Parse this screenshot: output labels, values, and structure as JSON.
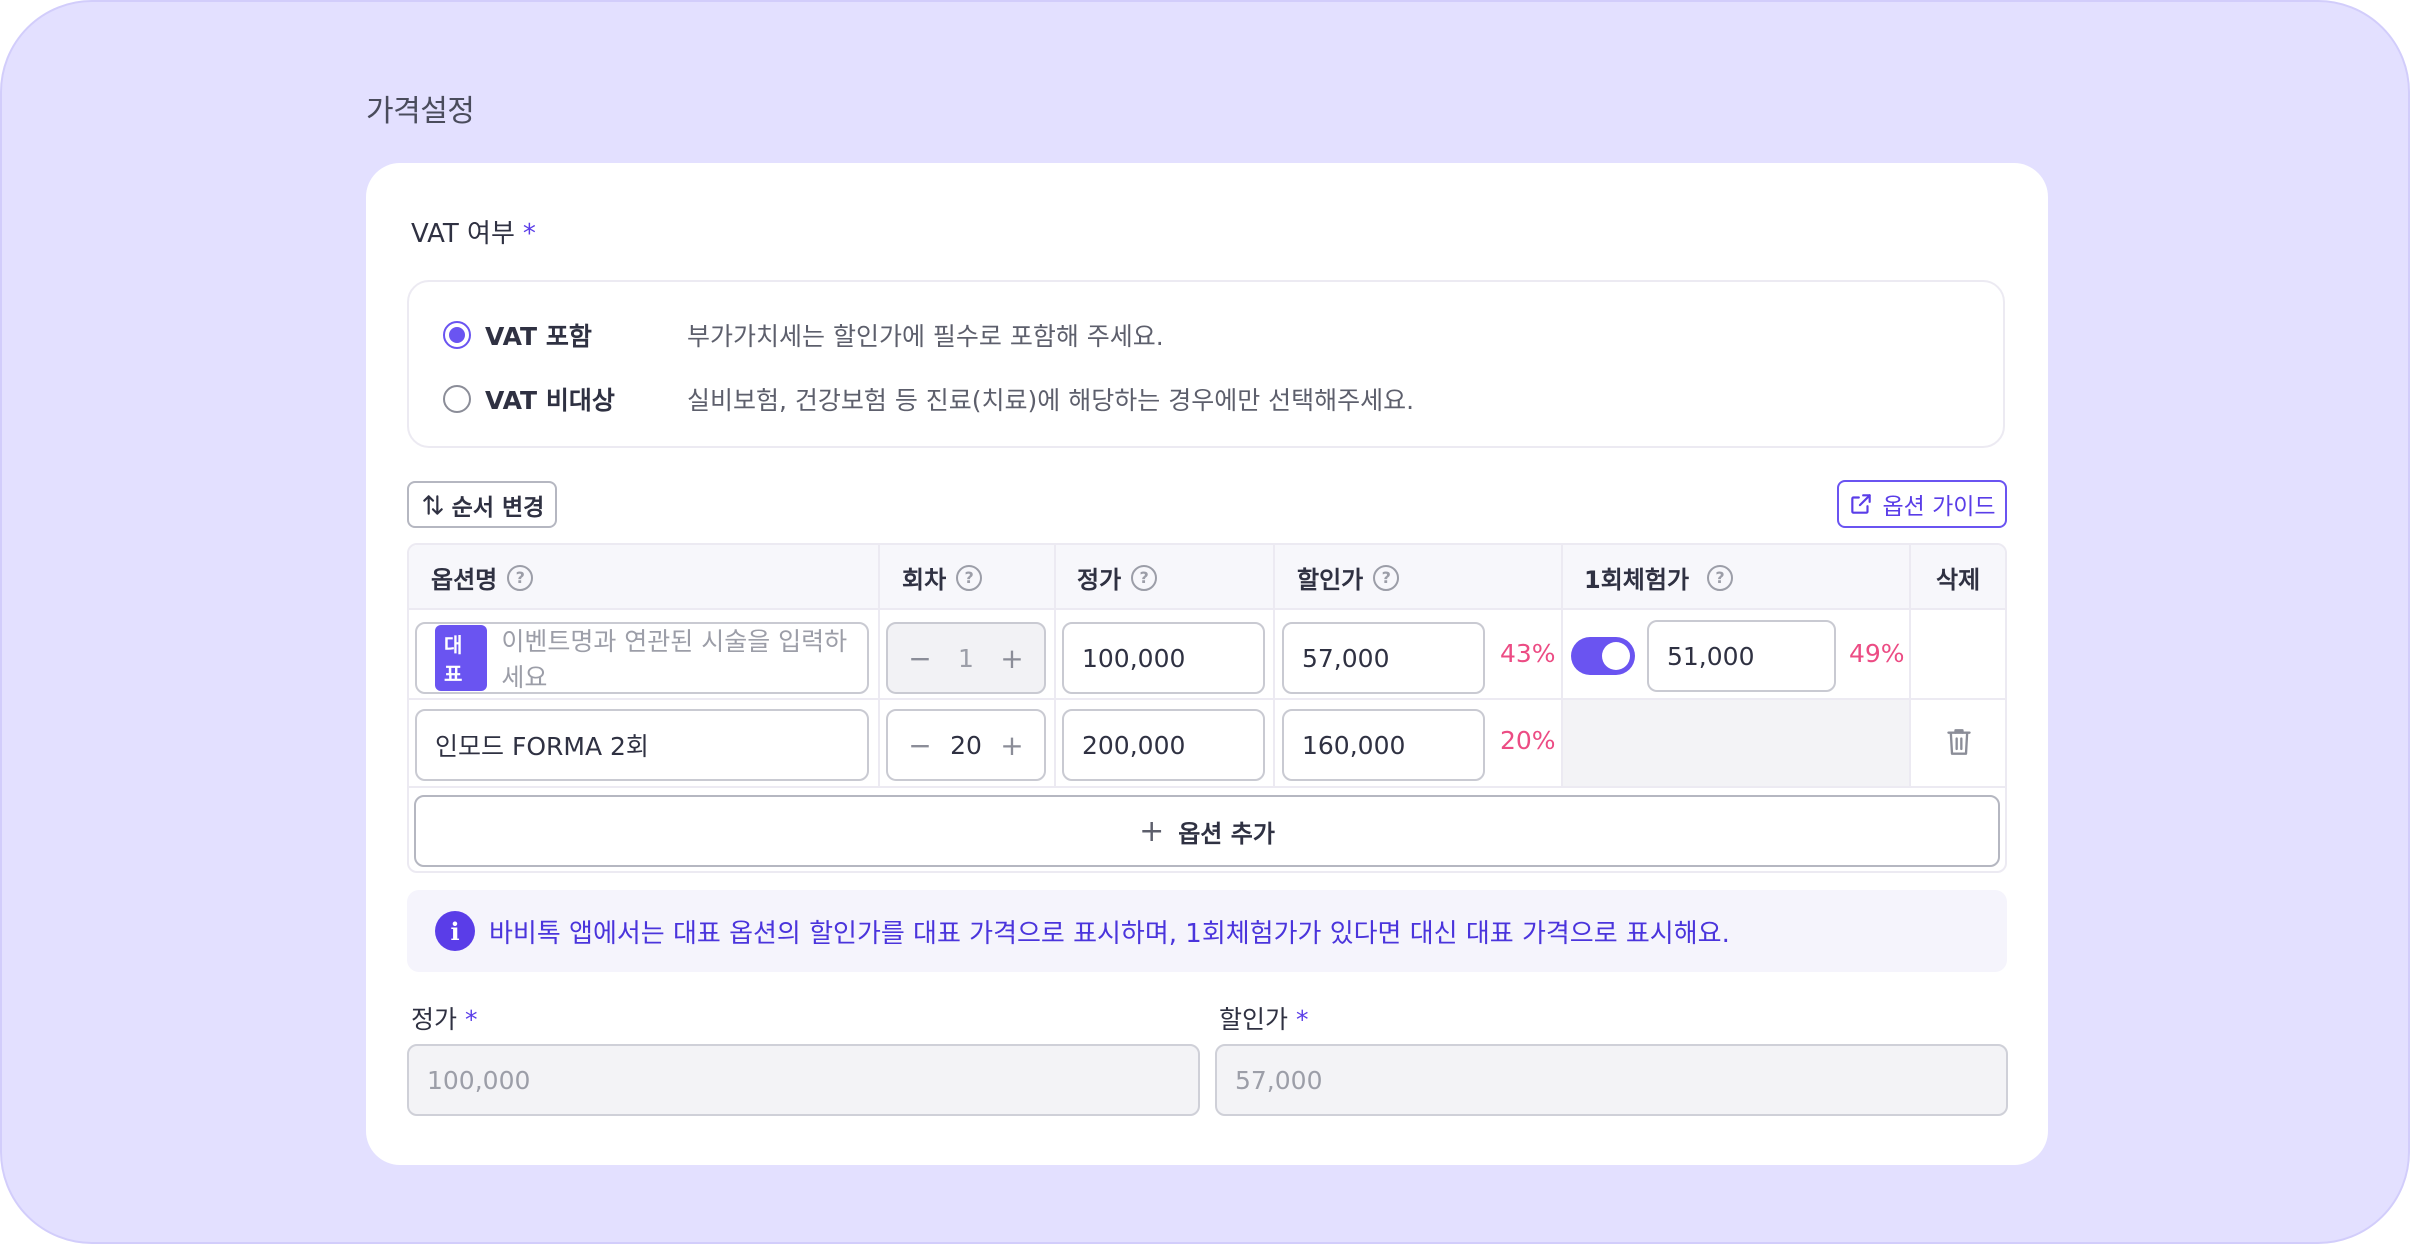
{
  "section_title": "가격설정",
  "vat": {
    "label": "VAT 여부",
    "required_mark": "*",
    "options": [
      {
        "name": "VAT 포함",
        "desc": "부가가치세는 할인가에 필수로 포함해 주세요.",
        "checked": true
      },
      {
        "name": "VAT 비대상",
        "desc": "실비보험, 건강보험 등 진료(치료)에 해당하는 경우에만 선택해주세요.",
        "checked": false
      }
    ]
  },
  "toolbar": {
    "reorder_label": "순서 변경",
    "guide_label": "옵션 가이드"
  },
  "table": {
    "headers": {
      "option_name": "옵션명",
      "sessions": "회차",
      "list_price": "정가",
      "discount_price": "할인가",
      "trial_price": "1회체험가",
      "delete": "삭제"
    },
    "rows": [
      {
        "badge": "대표",
        "name_placeholder": "이벤트명과 연관된 시술을 입력하세요",
        "sessions": "1",
        "list_price": "100,000",
        "discount_price": "57,000",
        "discount_pct": "43%",
        "trial_enabled": true,
        "trial_price": "51,000",
        "trial_pct": "49%"
      },
      {
        "name": "인모드 FORMA 2회",
        "sessions": "20",
        "list_price": "200,000",
        "discount_price": "160,000",
        "discount_pct": "20%"
      }
    ],
    "add_label": "옵션 추가",
    "minus_symbol": "−",
    "plus_symbol": "+"
  },
  "info": {
    "icon": "i",
    "text": "바비톡 앱에서는 대표 옵션의 할인가를 대표 가격으로 표시하며, 1회체험가가 있다면 대신 대표 가격으로 표시해요."
  },
  "summary": {
    "list_price_label": "정가",
    "list_price_value": "100,000",
    "discount_price_label": "할인가",
    "discount_price_value": "57,000"
  },
  "colors": {
    "background": "#e3e0ff",
    "accent": "#6a54f1",
    "percent": "#ec4c84"
  }
}
